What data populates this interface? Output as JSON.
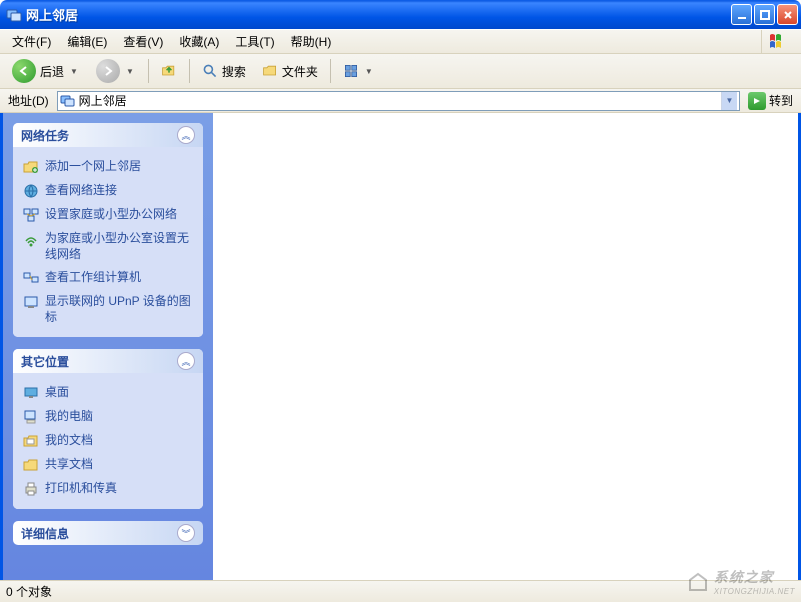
{
  "window": {
    "title": "网上邻居"
  },
  "menu": {
    "file": "文件(F)",
    "edit": "编辑(E)",
    "view": "查看(V)",
    "favorites": "收藏(A)",
    "tools": "工具(T)",
    "help": "帮助(H)"
  },
  "toolbar": {
    "back": "后退",
    "search": "搜索",
    "folders": "文件夹"
  },
  "address": {
    "label": "地址(D)",
    "value": "网上邻居",
    "go": "转到"
  },
  "panels": {
    "network_tasks": {
      "title": "网络任务",
      "items": [
        "添加一个网上邻居",
        "查看网络连接",
        "设置家庭或小型办公网络",
        "为家庭或小型办公室设置无线网络",
        "查看工作组计算机",
        "显示联网的 UPnP 设备的图标"
      ]
    },
    "other_places": {
      "title": "其它位置",
      "items": [
        "桌面",
        "我的电脑",
        "我的文档",
        "共享文档",
        "打印机和传真"
      ]
    },
    "details": {
      "title": "详细信息"
    }
  },
  "status": {
    "text": "0 个对象"
  },
  "watermark": {
    "text": "系统之家",
    "url": "XITONGZHIJIA.NET"
  }
}
